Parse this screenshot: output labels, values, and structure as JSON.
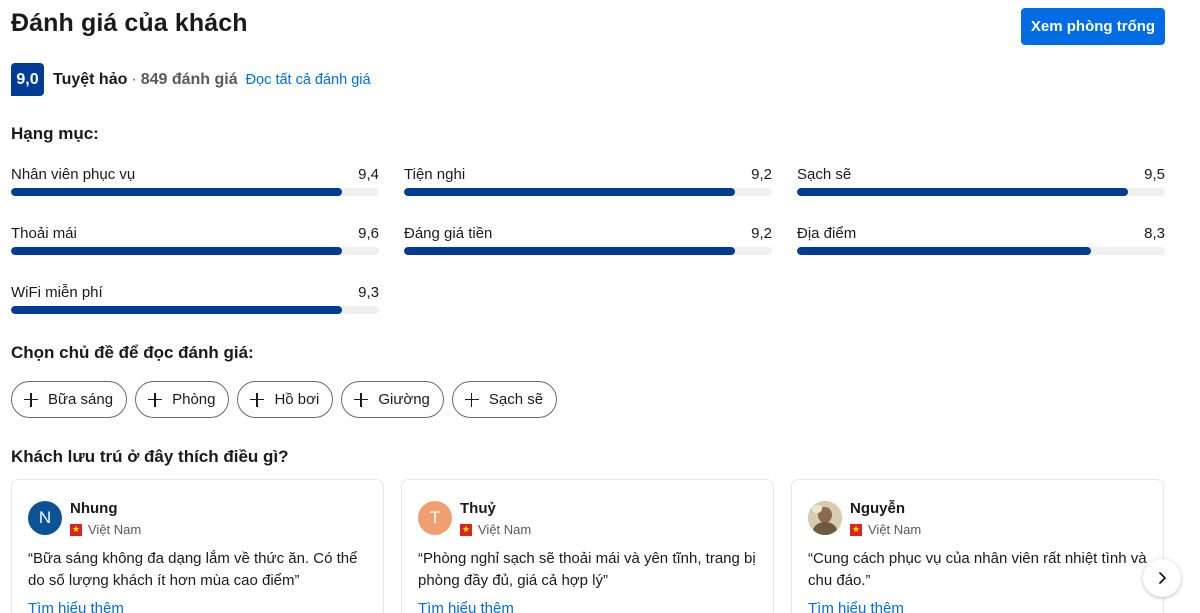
{
  "header": {
    "title": "Đánh giá của khách",
    "cta_label": "Xem phòng trống"
  },
  "score": {
    "value": "9,0",
    "label": "Tuyệt hảo",
    "separator": "·",
    "count": "849 đánh giá",
    "read_all": "Đọc tất cả đánh giá"
  },
  "categories": {
    "heading": "Hạng mục:",
    "items": [
      {
        "name": "Nhân viên phục vụ",
        "value": "9,4",
        "fill": 0.9
      },
      {
        "name": "Tiện nghi",
        "value": "9,2",
        "fill": 0.9
      },
      {
        "name": "Sạch sẽ",
        "value": "9,5",
        "fill": 0.9
      },
      {
        "name": "Thoải mái",
        "value": "9,6",
        "fill": 0.9
      },
      {
        "name": "Đáng giá tiền",
        "value": "9,2",
        "fill": 0.9
      },
      {
        "name": "Địa điểm",
        "value": "8,3",
        "fill": 0.8
      },
      {
        "name": "WiFi miễn phí",
        "value": "9,3",
        "fill": 0.9
      }
    ]
  },
  "topics": {
    "heading": "Chọn chủ đề để đọc đánh giá:",
    "items": [
      "Bữa sáng",
      "Phòng",
      "Hồ bơi",
      "Giường",
      "Sạch sẽ"
    ]
  },
  "reviews": {
    "heading": "Khách lưu trú ở đây thích điều gì?",
    "more_label": "Tìm hiểu thêm",
    "items": [
      {
        "initial": "N",
        "avatar_color": "#0b5394",
        "name": "Nhung",
        "country": "Việt Nam",
        "text": "“Bữa sáng không đa dạng lắm về thức ăn. Có thể do số lượng khách ít hơn mùa cao điểm”"
      },
      {
        "initial": "T",
        "avatar_color": "#f0a070",
        "name": "Thuỷ",
        "country": "Việt Nam",
        "text": "“Phòng nghỉ sạch sẽ thoải mái và yên tĩnh, trang bị phòng đầy đủ, giá cả hợp lý”"
      },
      {
        "initial": "",
        "avatar_color": "#c9b48a",
        "name": "Nguyễn",
        "country": "Việt Nam",
        "text": "“Cung cách phục vụ của nhân viên rất nhiệt tình và chu đáo.”"
      }
    ]
  },
  "icons": {
    "plus": "plus-icon",
    "next": "chevron-right-icon",
    "flag": "vietnam-flag-icon"
  },
  "colors": {
    "brand_blue": "#003b95",
    "action_blue": "#006ce4"
  }
}
